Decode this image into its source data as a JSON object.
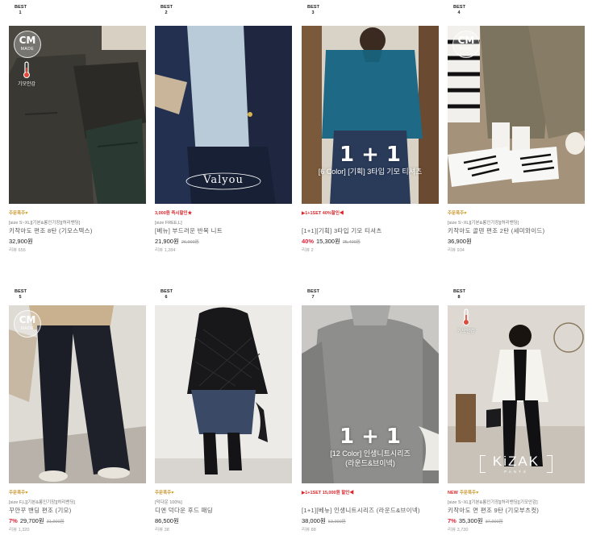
{
  "best_label": "BEST",
  "products": [
    {
      "rank": "1",
      "tag": "주문폭주",
      "tag_style": "gold",
      "size": "[size S~XL][기본&롱인기장][허리밴딩]",
      "name": "키작아도 편조 8탄 (기모스텍스)",
      "price": "32,900원",
      "discount": "",
      "original": "",
      "review": "리뷰 655",
      "overlay": {
        "logo": true,
        "logo_text": "MADE",
        "thermo": "기모안감"
      },
      "colors": {
        "bg": "#3e3b35",
        "accent": "#2c3a33"
      }
    },
    {
      "rank": "2",
      "tag": "3,000원 즉시할인★",
      "tag_style": "red",
      "size": "[size FREE,L]",
      "name": "[베뉴] 부드러운 반목 니트",
      "price": "21,900원",
      "discount": "",
      "original": "26,900원",
      "review": "리뷰 1,284",
      "overlay": {
        "brand": "Valyou"
      },
      "colors": {
        "bg": "#c9d6e0",
        "accent": "#1f2740"
      }
    },
    {
      "rank": "3",
      "tag": "▶1+1SET 40%할인◀",
      "tag_style": "red",
      "size": "",
      "name": "[1+1][기획] 3타입 기모 티셔츠",
      "price": "15,300원",
      "discount": "40%",
      "original": "25,400원",
      "review": "리뷰 2",
      "overlay": {
        "big": "1 + 1",
        "sub": "[6 Color] [기획] 3타입 기모 티셔츠"
      },
      "colors": {
        "bg": "#1e6a86",
        "accent": "#2a3b5a"
      }
    },
    {
      "rank": "4",
      "tag": "주문폭주",
      "tag_style": "gold",
      "size": "[size S~XL][기본&롱인기장][허리밴딩]",
      "name": "키작아도 골덴 편조 2탄 (세미와이드)",
      "price": "36,900원",
      "discount": "",
      "original": "",
      "review": "리뷰 934",
      "overlay": {
        "logo": true,
        "logo_text": "MADE"
      },
      "colors": {
        "bg": "#8a7e6a",
        "accent": "#f1efea"
      }
    },
    {
      "rank": "5",
      "tag": "주문폭주",
      "tag_style": "gold",
      "size": "[size F,L][기본&롱인기장][허리밴딩]",
      "name": "꾸안꾸 밴딩 편조 (기모)",
      "price": "29,700원",
      "discount": "7%",
      "original": "31,900원",
      "review": "리뷰 1,320",
      "overlay": {
        "logo": true,
        "logo_text": "MADE"
      },
      "colors": {
        "bg": "#d6d2cc",
        "accent": "#1b1e26"
      }
    },
    {
      "rank": "6",
      "tag": "주문폭주",
      "tag_style": "gold",
      "size": "[덕다운 100%]",
      "name": "디엔 덕다운 후드 패딩",
      "price": "86,500원",
      "discount": "",
      "original": "",
      "review": "리뷰 38",
      "overlay": {},
      "colors": {
        "bg": "#e8e6e2",
        "accent": "#1a1a1c"
      }
    },
    {
      "rank": "7",
      "tag": "▶1+1SET 15,000원 할인◀",
      "tag_style": "red",
      "size": "",
      "name": "[1+1][베뉴] 인생니트시리즈 (라운드&브이넥)",
      "price": "38,000원",
      "discount": "",
      "original": "53,000원",
      "review": "리뷰 88",
      "overlay": {
        "big": "1 + 1",
        "sub": "[12 Color] 인생니트시리즈",
        "sub2": "(라운드&브이넥)"
      },
      "colors": {
        "bg": "#9a9a98",
        "accent": "#8c8c8a"
      }
    },
    {
      "rank": "8",
      "tag": "주문폭주",
      "tag_style": "gold",
      "tag_prefix": "NEW",
      "size": "[size S~XL][기본&롱인기장][허리밴딩][기모안감]",
      "name": "키작아도 면 편조 9탄 (기모부츠컷)",
      "price": "35,300원",
      "discount": "7%",
      "original": "37,900원",
      "review": "리뷰 3,730",
      "overlay": {
        "thermo": "기모안감",
        "brand": "KiZAK",
        "brand_sub": "PANTS"
      },
      "colors": {
        "bg": "#d9d5cf",
        "accent": "#111114"
      }
    }
  ]
}
